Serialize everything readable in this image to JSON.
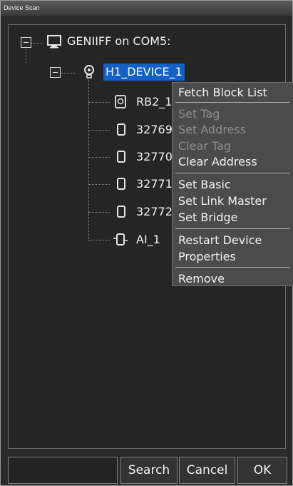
{
  "window": {
    "title": "Device Scan"
  },
  "tree": {
    "root": {
      "label": "GENIIFF on COM5:",
      "icon": "monitor-icon"
    },
    "device": {
      "label": "H1_DEVICE_1",
      "icon": "lightbulb-icon",
      "selected": true
    },
    "children": [
      {
        "label": "RB2_1",
        "icon": "resource-block-icon"
      },
      {
        "label": "32769",
        "icon": "block-icon"
      },
      {
        "label": "32770",
        "icon": "block-icon"
      },
      {
        "label": "32771",
        "icon": "block-icon"
      },
      {
        "label": "32772",
        "icon": "block-icon"
      },
      {
        "label": "AI_1",
        "icon": "function-block-icon"
      }
    ]
  },
  "context_menu": {
    "items": [
      {
        "label": "Fetch Block List",
        "enabled": true
      },
      {
        "label": "Set Tag",
        "enabled": false
      },
      {
        "label": "Set Address",
        "enabled": false
      },
      {
        "label": "Clear Tag",
        "enabled": false
      },
      {
        "label": "Clear Address",
        "enabled": true
      },
      {
        "label": "Set Basic",
        "enabled": true
      },
      {
        "label": "Set Link Master",
        "enabled": true
      },
      {
        "label": "Set Bridge",
        "enabled": true
      },
      {
        "label": "Restart Device",
        "enabled": true
      },
      {
        "label": "Properties",
        "enabled": true
      },
      {
        "label": "Remove",
        "enabled": true
      }
    ]
  },
  "bottom": {
    "input_value": "",
    "search_label": "Search",
    "cancel_label": "Cancel",
    "ok_label": "OK"
  }
}
